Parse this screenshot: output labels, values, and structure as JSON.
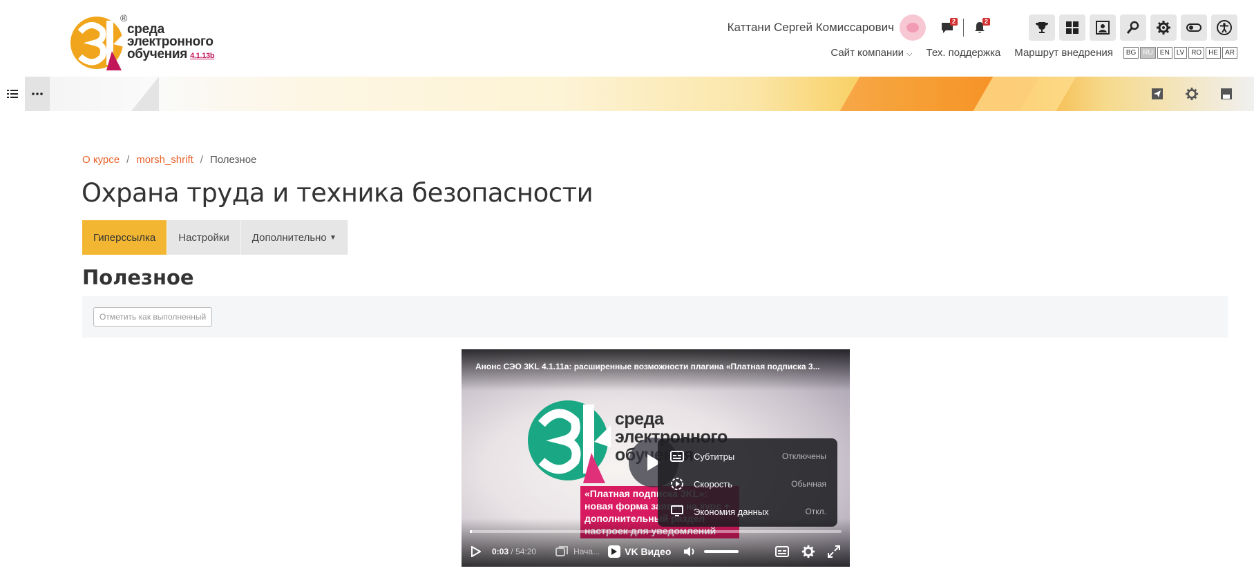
{
  "header": {
    "logo_line1": "среда",
    "logo_line2": "электронного",
    "logo_line3": "обучения",
    "logo_version": "4.1.13b",
    "logo_reg": "®",
    "user_name": "Каттани Сергей Комиссарович",
    "messages_count": "2",
    "notifications_count": "2",
    "links": {
      "company_site": "Сайт компании",
      "support": "Тех. поддержка",
      "route": "Маршрут внедрения"
    },
    "languages": [
      "BG",
      "RU",
      "EN",
      "LV",
      "RO",
      "HE",
      "AR"
    ],
    "active_language": "RU"
  },
  "breadcrumb": {
    "item1": "О курсе",
    "item2": "morsh_shrift",
    "current": "Полезное",
    "separator": "/"
  },
  "page_title": "Охрана труда и техника безопасности",
  "tabs": {
    "hyperlink": "Гиперссылка",
    "settings": "Настройки",
    "more": "Дополнительно"
  },
  "section_title": "Полезное",
  "completion": {
    "button_label": "Отметить как выполненный"
  },
  "video": {
    "title": "Анонс СЭО 3KL 4.1.11а: расширенные возможности плагина «Платная подписка 3...",
    "logo_line1": "среда",
    "logo_line2": "электронного",
    "logo_line3": "обучения",
    "promo_text": "«Платная подписка 3KL»: новая форма заявки на курс + дополнительный раздел настроек для уведомлений",
    "current_time": "0:03",
    "time_separator": "/",
    "duration": "54:20",
    "chapter": "Нача...",
    "brand": "VK Видео",
    "progress_fraction": 0.006,
    "menu": [
      {
        "label": "Субтитры",
        "value": "Отключены",
        "icon": "subtitles-icon"
      },
      {
        "label": "Скорость",
        "value": "Обычная",
        "icon": "speed-icon"
      },
      {
        "label": "Экономия данных",
        "value": "Откл.",
        "icon": "data-saver-icon"
      }
    ]
  },
  "colors": {
    "accent": "#f2b632",
    "link": "#e8622b",
    "badge": "#d32f2f",
    "promo": "#d81b60"
  }
}
